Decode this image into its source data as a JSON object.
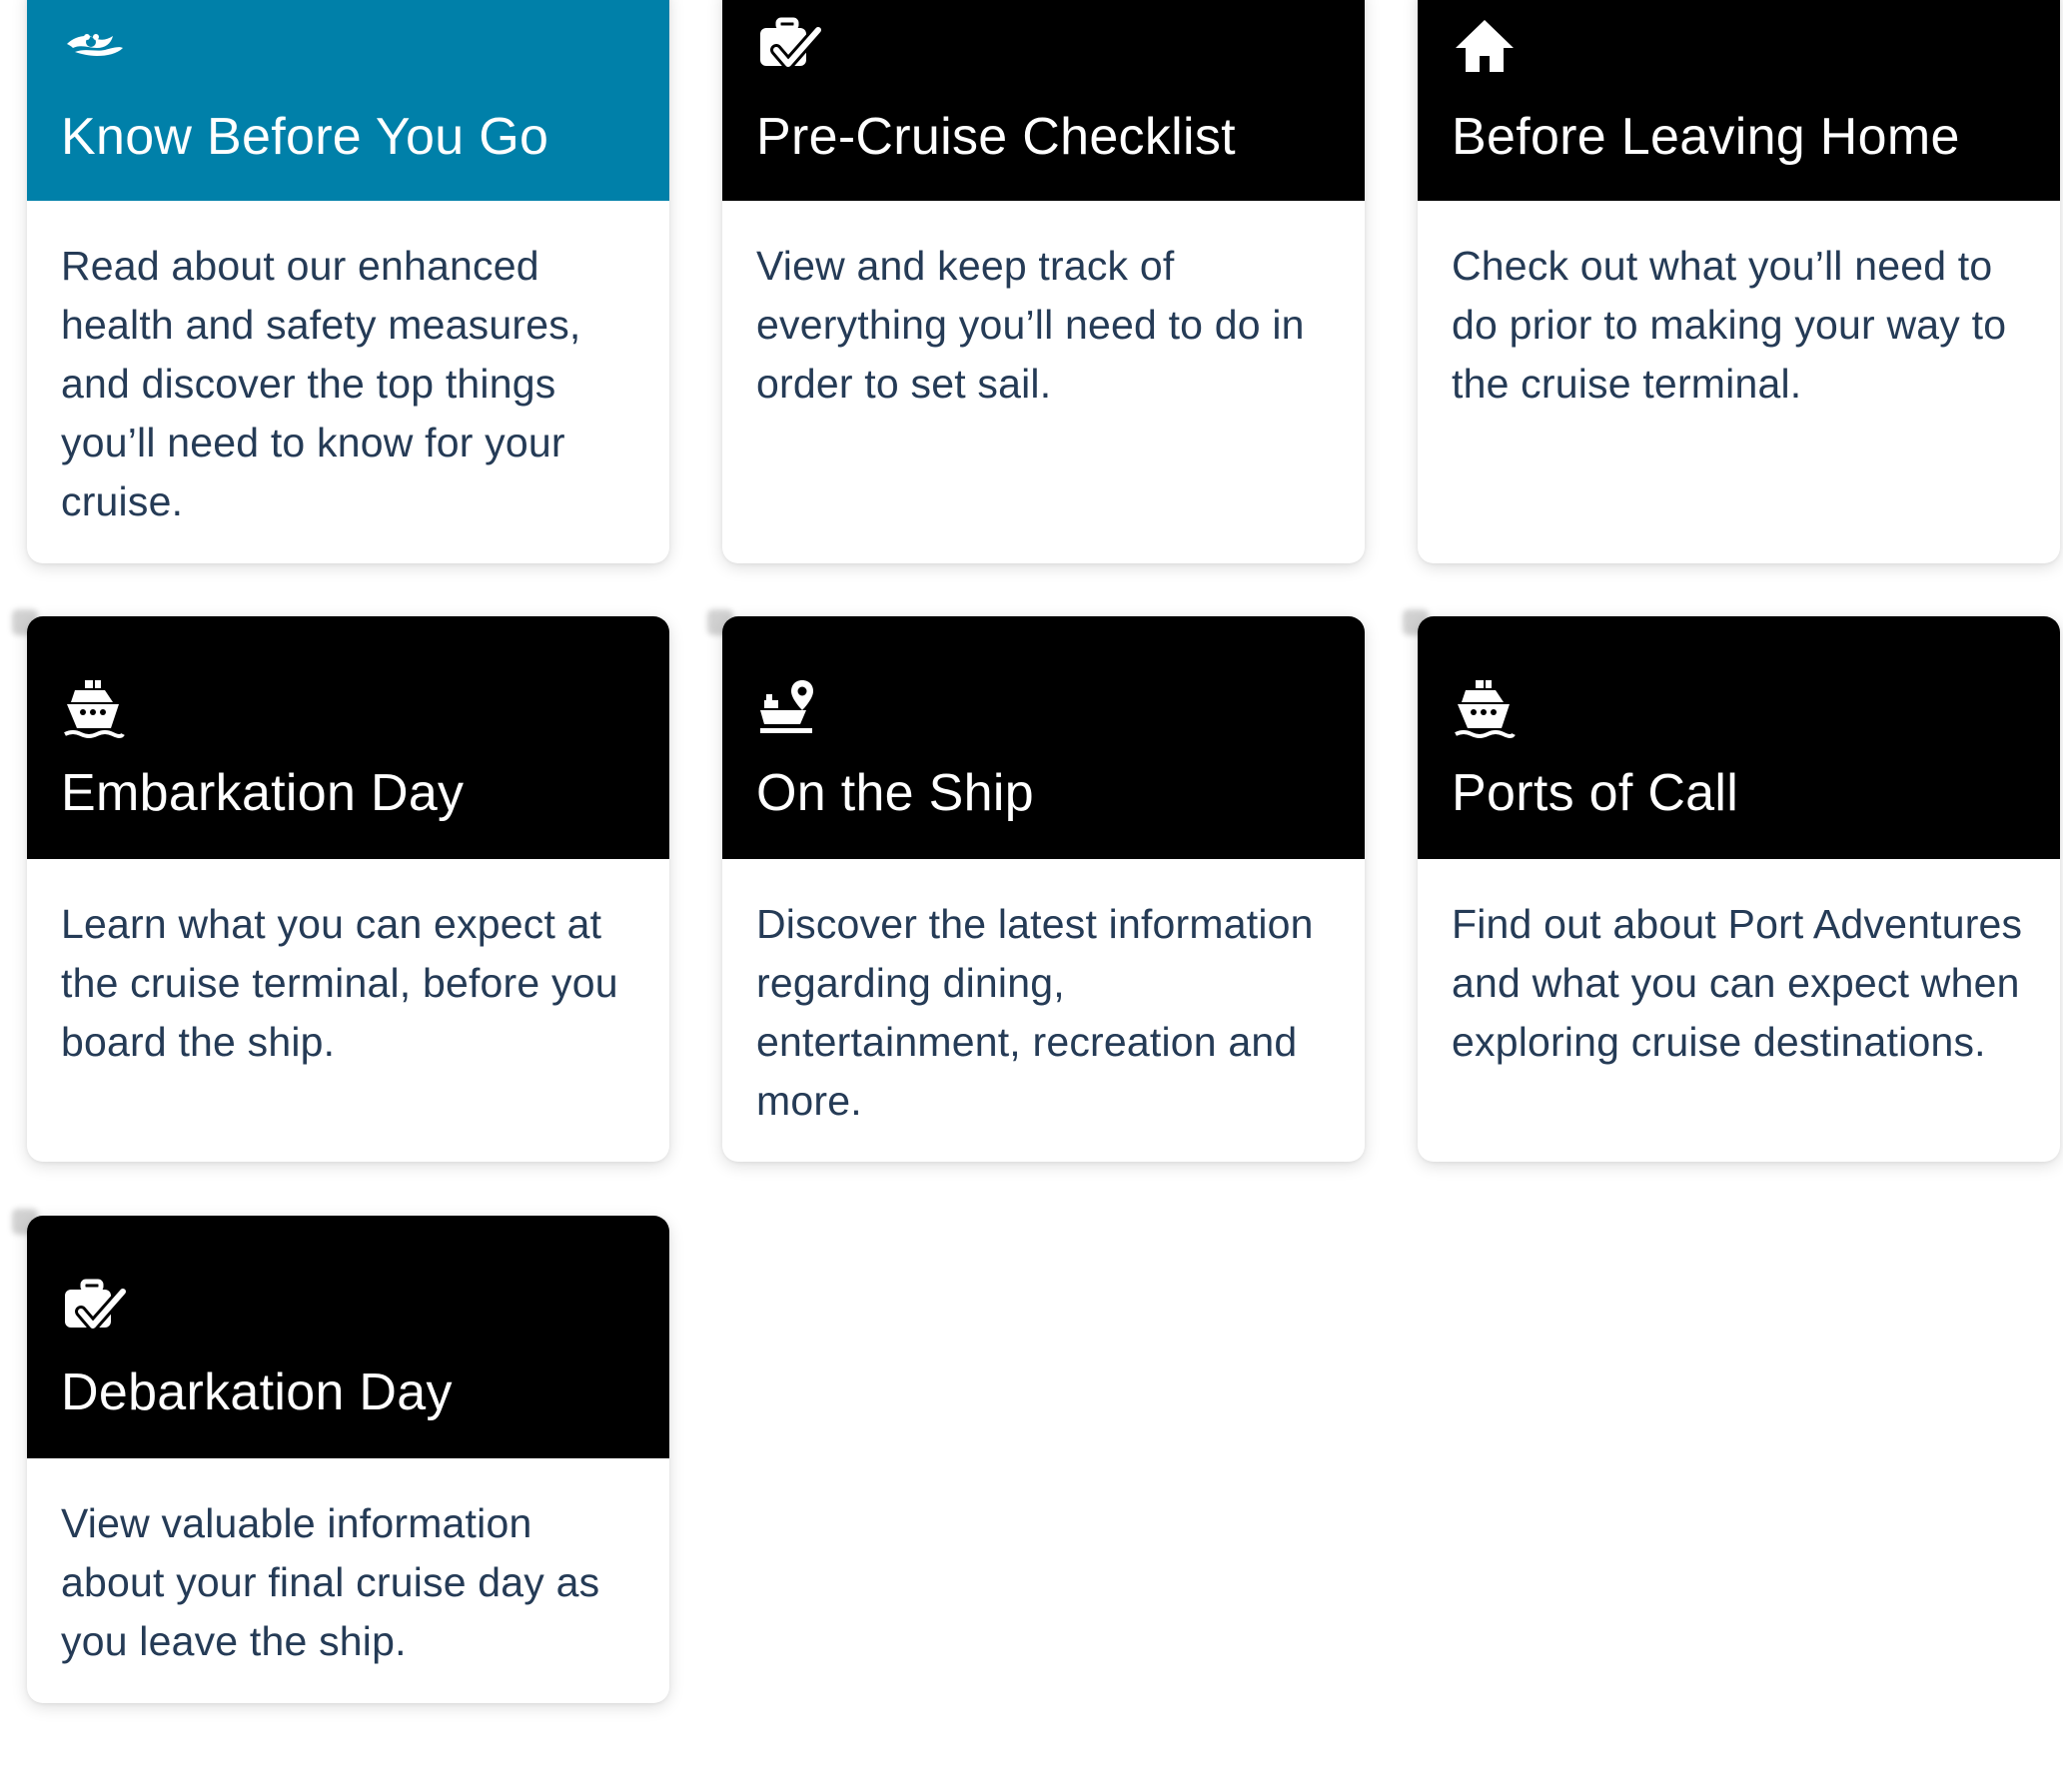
{
  "cards": [
    {
      "title": "Know Before You Go",
      "description": "Read about our enhanced health and safety measures, and discover the top things you’ll need to know for your cruise.",
      "icon": "disney-cruise-line-logo-icon",
      "header_color": "#0080a9",
      "active": true
    },
    {
      "title": "Pre-Cruise Checklist",
      "description": "View and keep track of everything you’ll need to do in order to set sail.",
      "icon": "luggage-check-icon",
      "header_color": "#000000"
    },
    {
      "title": "Before Leaving Home",
      "description": "Check out what you’ll need to do prior to making your way to the cruise terminal.",
      "icon": "home-icon",
      "header_color": "#000000"
    },
    {
      "title": "Embarkation Day",
      "description": "Learn what you can expect at the cruise terminal, before you board the ship.",
      "icon": "cruise-ship-icon",
      "header_color": "#000000"
    },
    {
      "title": "On the Ship",
      "description": "Discover the latest information regarding dining, entertainment, recreation and more.",
      "icon": "ship-location-pin-icon",
      "header_color": "#000000"
    },
    {
      "title": "Ports of Call",
      "description": "Find out about Port Adventures and what you can expect when exploring cruise destinations.",
      "icon": "cruise-ship-icon",
      "header_color": "#000000"
    },
    {
      "title": "Debarkation Day",
      "description": "View valuable information about your final cruise day as you leave the ship.",
      "icon": "luggage-check-icon",
      "header_color": "#000000"
    }
  ],
  "colors": {
    "accent": "#0080a9",
    "header_dark": "#000000",
    "body_text": "#253b56",
    "background": "#ffffff"
  }
}
